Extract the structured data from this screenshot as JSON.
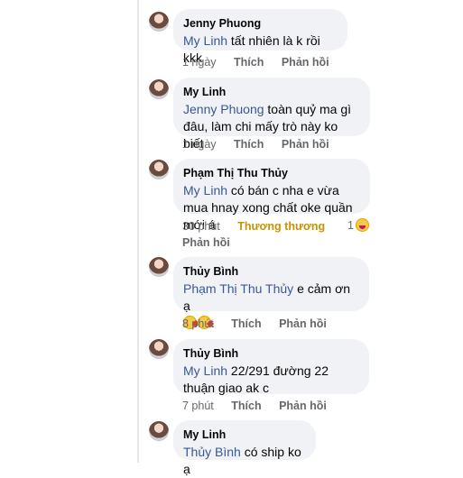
{
  "comments": [
    {
      "author": "Jenny Phuong",
      "mention": "My Linh",
      "text": " tất nhiên là k rồi kkk",
      "time": "1 ngày",
      "like": "Thích",
      "reply": "Phản hồi"
    },
    {
      "author": "My Linh",
      "mention": "Jenny Phuong",
      "text": " toàn quỷ ma gì đâu, làm chi mấy trò này ko biết",
      "time": "1 ngày",
      "like": "Thích",
      "reply": "Phản hồi"
    },
    {
      "author": "Phạm Thị Thu Thủy",
      "mention": "My Linh",
      "text": " có bán c nha e vừa mua hnay xong chất oke quần mới á",
      "time": "30 phút",
      "reaction_label": "Thương thương",
      "reaction_count": "1",
      "reaction_icon": "haha-icon",
      "reply": "Phản hồi"
    },
    {
      "author": "Thủy Bình",
      "mention": "Phạm Thị Thu Thủy",
      "text": " e cảm ơn ạ",
      "text_suffix": ".",
      "emojis": [
        "kissing-face-icon",
        "kissing-face-icon"
      ],
      "time": "8 phút",
      "like": "Thích",
      "reply": "Phản hồi"
    },
    {
      "author": "Thủy Bình",
      "mention": "My Linh",
      "text": " 22/291 đường 22 thuận giao ak c",
      "time": "7 phút",
      "like": "Thích",
      "reply": "Phản hồi"
    },
    {
      "author": "My Linh",
      "mention": "Thủy Bình",
      "text": " có ship ko ạ"
    }
  ],
  "colors": {
    "bubble": "#f0f2f5",
    "mention": "#385898",
    "reaction": "#c99200",
    "meta": "#65676b"
  }
}
